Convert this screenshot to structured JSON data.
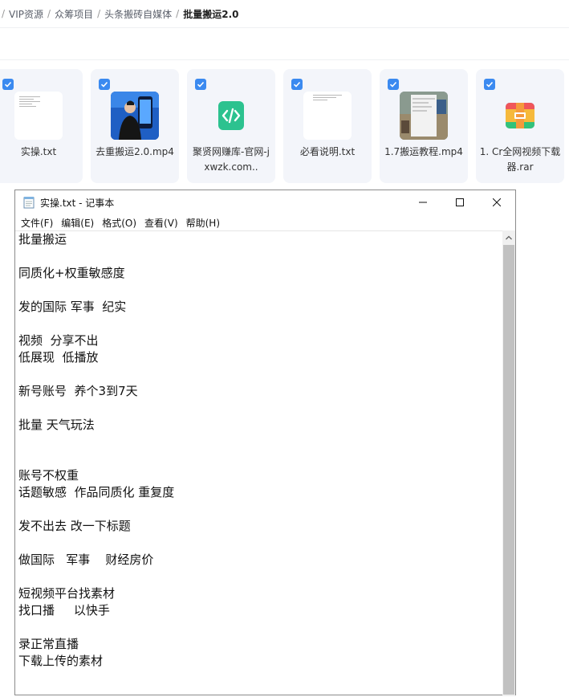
{
  "breadcrumb": {
    "items": [
      "VIP资源",
      "众筹项目",
      "头条搬砖自媒体",
      "批量搬运2.0"
    ]
  },
  "files": [
    {
      "name": "实操.txt",
      "type": "txt",
      "checked": true
    },
    {
      "name": "去重搬运2.0.mp4",
      "type": "video-person",
      "checked": true
    },
    {
      "name": "聚贤网赚库-官网-jxwzk.com..",
      "type": "link",
      "checked": true
    },
    {
      "name": "必看说明.txt",
      "type": "txt",
      "checked": true
    },
    {
      "name": "1.7搬运教程.mp4",
      "type": "video-screen",
      "checked": true
    },
    {
      "name": "1. Cr全网视频下载器.rar",
      "type": "rar",
      "checked": true
    }
  ],
  "notepad": {
    "title": "实操.txt - 记事本",
    "menu": [
      "文件(F)",
      "编辑(E)",
      "格式(O)",
      "查看(V)",
      "帮助(H)"
    ],
    "lines": [
      "批量搬运",
      "",
      "同质化+权重敏感度",
      "",
      "发的国际 军事  纪实",
      "",
      "视频  分享不出",
      "低展现  低播放",
      "",
      "新号账号  养个3到7天",
      "",
      "批量 天气玩法",
      "",
      "",
      "账号不权重",
      "话题敏感  作品同质化 重复度",
      "",
      "发不出去 改一下标题",
      "",
      "做国际   军事    财经房价",
      "",
      "短视频平台找素材",
      "找口播     以快手",
      "",
      "录正常直播",
      "下载上传的素材",
      "",
      ""
    ]
  },
  "colors": {
    "accent": "#3b8af0",
    "card_bg": "#f3f5fa",
    "link_icon": "#2cc28f"
  }
}
